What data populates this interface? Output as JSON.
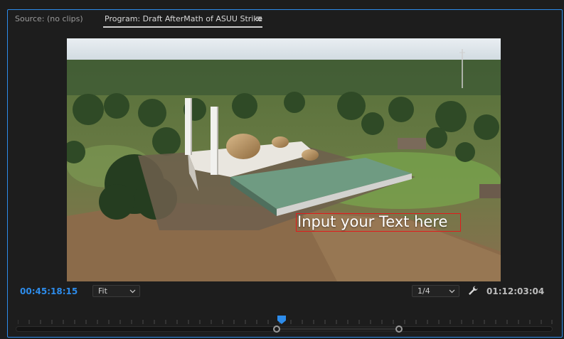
{
  "tabs": {
    "source": "Source: (no clips)",
    "program": "Program: Draft AfterMath of ASUU Strike",
    "program_menu_icon": "hamburger-menu-icon"
  },
  "viewer": {
    "overlay_text": "Input your Text here",
    "overlay_border_color": "#e01b1b"
  },
  "controls": {
    "current_timecode": "00:45:18:15",
    "zoom_select": "Fit",
    "resolution_select": "1/4",
    "settings_icon": "wrench-icon",
    "duration_timecode": "01:12:03:04"
  },
  "colors": {
    "accent": "#2d8ceb",
    "panel_bg": "#1d1d1d"
  }
}
